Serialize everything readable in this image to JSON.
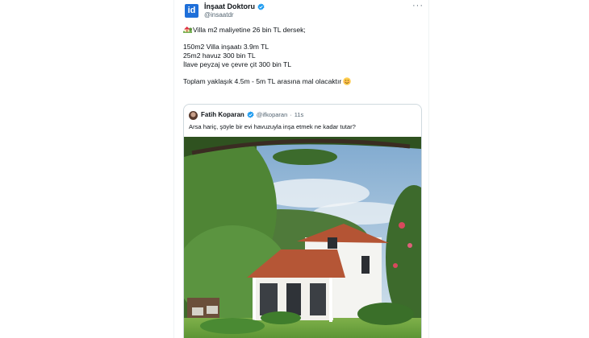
{
  "author": {
    "display_name": "İnşaat Doktoru",
    "handle": "@insaatdr",
    "avatar_text": "id",
    "verified": true
  },
  "menu_icon": "more-horizontal-icon",
  "body": {
    "line1": "Villa m2 maliyetine 26 bin TL dersek;",
    "line2": "150m2 Villa inşaatı 3.9m TL",
    "line3": "25m2 havuz 300 bin TL",
    "line4": "İlave peyzaj ve çevre çit 300 bin TL",
    "line5": "Toplam yaklaşık 4.5m - 5m TL arasına mal olacaktır",
    "emoji_start": "house-with-garden-emoji",
    "emoji_end": "smiling-face-emoji"
  },
  "quoted_tweet": {
    "display_name": "Fatih Koparan",
    "handle": "@ifkoparan",
    "separator": "·",
    "time": "11s",
    "verified": true,
    "text": "Arsa hariç, şöyle bir evi havuzuyla inşa etmek ne kadar tutar?",
    "media": "photo-white-villa-with-tiled-roof-in-garden"
  },
  "colors": {
    "verified_blue": "#1d9bf0",
    "text_primary": "#0f1419",
    "text_secondary": "#536471",
    "border": "#cfd9de",
    "brand_avatar": "#1e6fd9"
  }
}
